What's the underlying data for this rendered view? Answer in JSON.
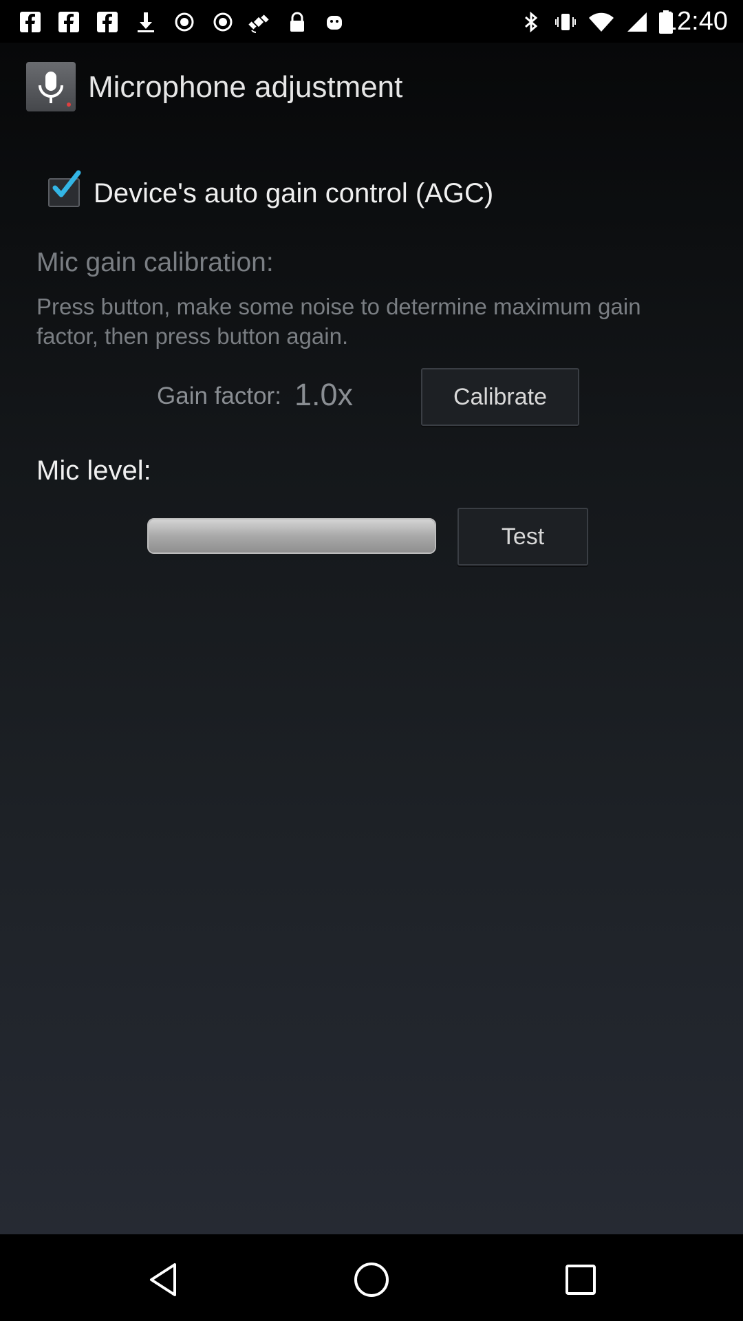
{
  "status_bar": {
    "time": "12:40",
    "left_icons": [
      "facebook-icon",
      "facebook-icon",
      "facebook-icon",
      "download-icon",
      "record-icon",
      "record-icon",
      "gps-fake-icon",
      "lock-icon",
      "android-icon"
    ],
    "right_icons": [
      "bluetooth-icon",
      "vibrate-icon",
      "wifi-icon",
      "signal-icon",
      "battery-icon"
    ]
  },
  "header": {
    "title": "Microphone adjustment",
    "icon": "microphone-icon"
  },
  "agc": {
    "label": "Device's auto gain control (AGC)",
    "checked": true
  },
  "calibration": {
    "heading": "Mic gain calibration:",
    "description": "Press button, make some noise to determine maximum gain factor, then press button again.",
    "gain_label": "Gain factor:",
    "gain_value": "1.0x",
    "button_label": "Calibrate"
  },
  "mic_level": {
    "label": "Mic level:",
    "level": 1.0,
    "button_label": "Test"
  },
  "nav": {
    "icons": [
      "back-icon",
      "home-icon",
      "recents-icon"
    ]
  },
  "colors": {
    "accent_check": "#33b5e5",
    "text_primary": "#f0f0f0",
    "text_muted": "#7a7e83"
  }
}
